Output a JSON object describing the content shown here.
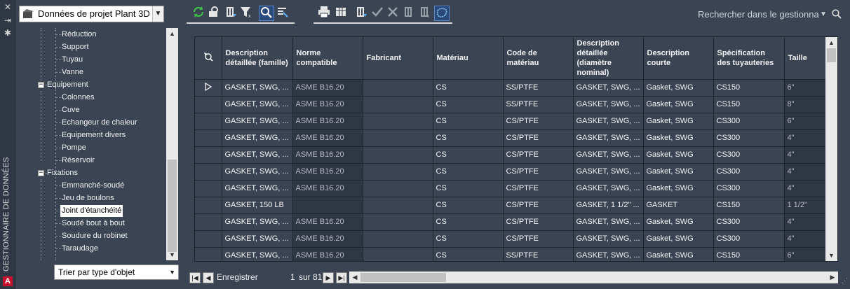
{
  "palette": {
    "title": "GESTIONNAIRE DE DONNÉES",
    "close_icon": "close-icon",
    "autohide_icon": "autohide-icon",
    "properties_icon": "properties-icon",
    "logo_letter": "A"
  },
  "project_selector": {
    "value": "Données de projet Plant 3D",
    "icon": "project-data-icon"
  },
  "tree": {
    "items": [
      {
        "label": "Réduction"
      },
      {
        "label": "Support"
      },
      {
        "label": "Tuyau"
      },
      {
        "label": "Vanne"
      },
      {
        "label": "Equipement"
      },
      {
        "label": "Colonnes"
      },
      {
        "label": "Cuve"
      },
      {
        "label": "Echangeur de chaleur"
      },
      {
        "label": "Equipement divers"
      },
      {
        "label": "Pompe"
      },
      {
        "label": "Réservoir"
      },
      {
        "label": "Fixations"
      },
      {
        "label": "Emmanché-soudé"
      },
      {
        "label": "Jeu de boulons"
      },
      {
        "label": "Joint d'étanchéité"
      },
      {
        "label": "Soudé bout à bout"
      },
      {
        "label": "Soudure du robinet"
      },
      {
        "label": "Taraudage"
      }
    ],
    "selected": "Joint d'étanchéité"
  },
  "sort_selector": {
    "value": "Trier par type d'objet"
  },
  "search": {
    "placeholder": "Rechercher dans le gestionna"
  },
  "grid": {
    "columns": [
      "Description détaillée (famille)",
      "Norme compatible",
      "Fabricant",
      "Matériau",
      "Code de matériau",
      "Description détaillée (diamètre nominal)",
      "Description courte",
      "Spécification des tuyauteries",
      "Taille"
    ],
    "rows": [
      [
        "GASKET, SWG, ...",
        "ASME B16.20",
        "",
        "CS",
        "SS/PTFE",
        "GASKET, SWG, ...",
        "Gasket, SWG",
        "CS150",
        "6\""
      ],
      [
        "GASKET, SWG, ...",
        "ASME B16.20",
        "",
        "CS",
        "SS/PTFE",
        "GASKET, SWG, ...",
        "Gasket, SWG",
        "CS150",
        "8\""
      ],
      [
        "GASKET, SWG, ...",
        "ASME B16.20",
        "",
        "CS",
        "CS/PTFE",
        "GASKET, SWG, ...",
        "Gasket, SWG",
        "CS300",
        "6\""
      ],
      [
        "GASKET, SWG, ...",
        "ASME B16.20",
        "",
        "CS",
        "CS/PTFE",
        "GASKET, SWG, ...",
        "Gasket, SWG",
        "CS300",
        "4\""
      ],
      [
        "GASKET, SWG, ...",
        "ASME B16.20",
        "",
        "CS",
        "CS/PTFE",
        "GASKET, SWG, ...",
        "Gasket, SWG",
        "CS300",
        "4\""
      ],
      [
        "GASKET, SWG, ...",
        "ASME B16.20",
        "",
        "CS",
        "CS/PTFE",
        "GASKET, SWG, ...",
        "Gasket, SWG",
        "CS300",
        "4\""
      ],
      [
        "GASKET, SWG, ...",
        "ASME B16.20",
        "",
        "CS",
        "CS/PTFE",
        "GASKET, SWG, ...",
        "Gasket, SWG",
        "CS300",
        "4\""
      ],
      [
        "GASKET, 150 LB",
        "",
        "",
        "CS",
        "CS/PTFE",
        "GASKET, 1 1/2\" ...",
        "GASKET",
        "CS150",
        "1 1/2\""
      ],
      [
        "GASKET, SWG, ...",
        "ASME B16.20",
        "",
        "CS",
        "CS/PTFE",
        "GASKET, SWG, ...",
        "Gasket, SWG",
        "CS300",
        "4\""
      ],
      [
        "GASKET, SWG, ...",
        "ASME B16.20",
        "",
        "CS",
        "CS/PTFE",
        "GASKET, SWG, ...",
        "Gasket, SWG",
        "CS300",
        "4\""
      ],
      [
        "GASKET, SWG, ...",
        "ASME B16.20",
        "",
        "CS",
        "SS/PTFE",
        "GASKET, SWG, ...",
        "Gasket, SWG",
        "CS150",
        "6\""
      ]
    ]
  },
  "navigator": {
    "label": "Enregistrer",
    "position": "1",
    "of": "sur",
    "total": "81"
  },
  "toolbar": {
    "icons": [
      "refresh-icon",
      "zoom-to-icon",
      "export-icon",
      "clear-filter-icon",
      "search-icon",
      "find-icon",
      "print-icon",
      "columns-icon",
      "import-icon",
      "accept-icon",
      "reject-icon",
      "accept-all-icon",
      "reject-all-icon",
      "highlight-icon"
    ]
  },
  "colors": {
    "panel_bg": "#3b4453",
    "readonly_cell_bg": "#2f3744",
    "highlight_button": "#29497a"
  }
}
